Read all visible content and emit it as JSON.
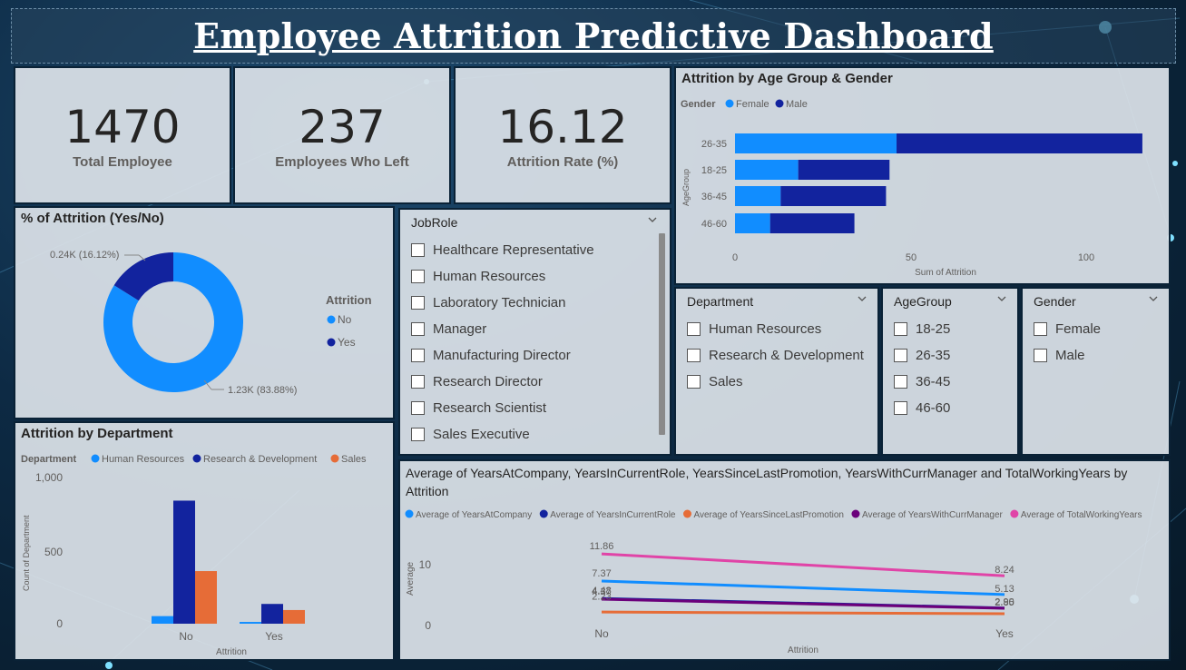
{
  "dashboard": {
    "title": "Employee Attrition Predictive Dashboard"
  },
  "kpis": [
    {
      "value": "1470",
      "label": "Total Employee"
    },
    {
      "value": "237",
      "label": "Employees Who Left"
    },
    {
      "value": "16.12",
      "label": "Attrition Rate (%)"
    }
  ],
  "colors": {
    "light_blue": "#118dff",
    "dark_blue": "#12239e",
    "orange": "#e66c37",
    "purple": "#6b007b",
    "pink": "#e044a7"
  },
  "donut": {
    "title": "% of Attrition (Yes/No)",
    "legend_title": "Attrition",
    "slices": [
      {
        "name": "No",
        "value": 83.88,
        "label": "1.23K (83.88%)"
      },
      {
        "name": "Yes",
        "value": 16.12,
        "label": "0.24K (16.12%)"
      }
    ]
  },
  "age_gender": {
    "title": "Attrition by Age Group & Gender",
    "legend_title": "Gender",
    "legend": [
      "Female",
      "Male"
    ],
    "ylabel": "AgeGroup",
    "xlabel": "Sum of Attrition",
    "xticks": [
      "0",
      "50",
      "100"
    ]
  },
  "dept_chart": {
    "title": "Attrition by Department",
    "legend_title": "Department",
    "legend": [
      "Human Resources",
      "Research & Development",
      "Sales"
    ],
    "ylabel": "Count of Department",
    "xlabel": "Attrition",
    "yticks": [
      "0",
      "500",
      "1,000"
    ]
  },
  "line_chart": {
    "title": "Average of YearsAtCompany, YearsInCurrentRole, YearsSinceLastPromotion, YearsWithCurrManager and TotalWorkingYears by Attrition",
    "ylabel": "Average",
    "xlabel": "Attrition",
    "yticks": [
      "0",
      "10"
    ]
  },
  "chart_data": [
    {
      "type": "bar",
      "orientation": "horizontal-stacked",
      "categories": [
        "26-35",
        "18-25",
        "36-45",
        "46-60"
      ],
      "series": [
        {
          "name": "Female",
          "values": [
            46,
            18,
            13,
            10
          ]
        },
        {
          "name": "Male",
          "values": [
            70,
            26,
            30,
            24
          ]
        }
      ],
      "xlim": [
        0,
        116
      ]
    },
    {
      "type": "bar",
      "categories": [
        "No",
        "Yes"
      ],
      "series": [
        {
          "name": "Human Resources",
          "values": [
            51,
            12
          ]
        },
        {
          "name": "Research & Development",
          "values": [
            828,
            133
          ]
        },
        {
          "name": "Sales",
          "values": [
            354,
            92
          ]
        }
      ],
      "ylim": [
        0,
        1000
      ]
    },
    {
      "type": "line",
      "categories": [
        "No",
        "Yes"
      ],
      "series": [
        {
          "name": "Average of YearsAtCompany",
          "values": [
            7.37,
            5.13
          ],
          "labels": [
            "7.37",
            "5.13"
          ]
        },
        {
          "name": "Average of YearsInCurrentRole",
          "values": [
            4.48,
            2.9
          ],
          "labels": [
            "4.48",
            "2.90"
          ]
        },
        {
          "name": "Average of YearsSinceLastPromotion",
          "values": [
            2.23,
            1.95
          ],
          "labels": []
        },
        {
          "name": "Average of YearsWithCurrManager",
          "values": [
            4.37,
            2.85
          ],
          "labels": [
            "4.37",
            "2.85"
          ]
        },
        {
          "name": "Average of TotalWorkingYears",
          "values": [
            11.86,
            8.24
          ],
          "labels": [
            "11.86",
            "8.24"
          ]
        }
      ],
      "extra_labels": [
        "2.23"
      ],
      "ylim": [
        0,
        13
      ]
    }
  ],
  "slicers": {
    "jobrole": {
      "title": "JobRole",
      "items": [
        "Healthcare Representative",
        "Human Resources",
        "Laboratory Technician",
        "Manager",
        "Manufacturing Director",
        "Research Director",
        "Research Scientist",
        "Sales Executive"
      ]
    },
    "department": {
      "title": "Department",
      "items": [
        "Human Resources",
        "Research & Development",
        "Sales"
      ]
    },
    "agegroup": {
      "title": "AgeGroup",
      "items": [
        "18-25",
        "26-35",
        "36-45",
        "46-60"
      ]
    },
    "gender": {
      "title": "Gender",
      "items": [
        "Female",
        "Male"
      ]
    }
  }
}
